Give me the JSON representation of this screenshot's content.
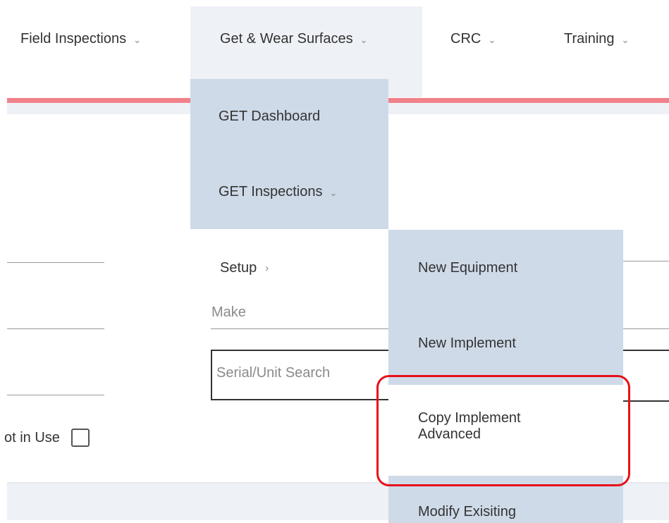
{
  "nav": {
    "items": [
      {
        "label": "Field Inspections"
      },
      {
        "label": "Get & Wear Surfaces"
      },
      {
        "label": "CRC"
      },
      {
        "label": "Training"
      }
    ]
  },
  "dropdown": {
    "get_dashboard": "GET Dashboard",
    "get_inspections": "GET Inspections",
    "setup": "Setup"
  },
  "submenu": {
    "new_equipment": "New Equipment",
    "new_implement": "New Implement",
    "copy_implement_advanced": "Copy Implement Advanced",
    "modify_existing": "Modify Exisiting"
  },
  "form": {
    "make_label": "Make",
    "serial_search_placeholder": "Serial/Unit Search",
    "not_in_use_label": "ot in Use"
  },
  "colors": {
    "accent_red_bar": "#f0828a",
    "menu_bg": "#cfdae8",
    "highlight_outline": "#e8101a"
  }
}
